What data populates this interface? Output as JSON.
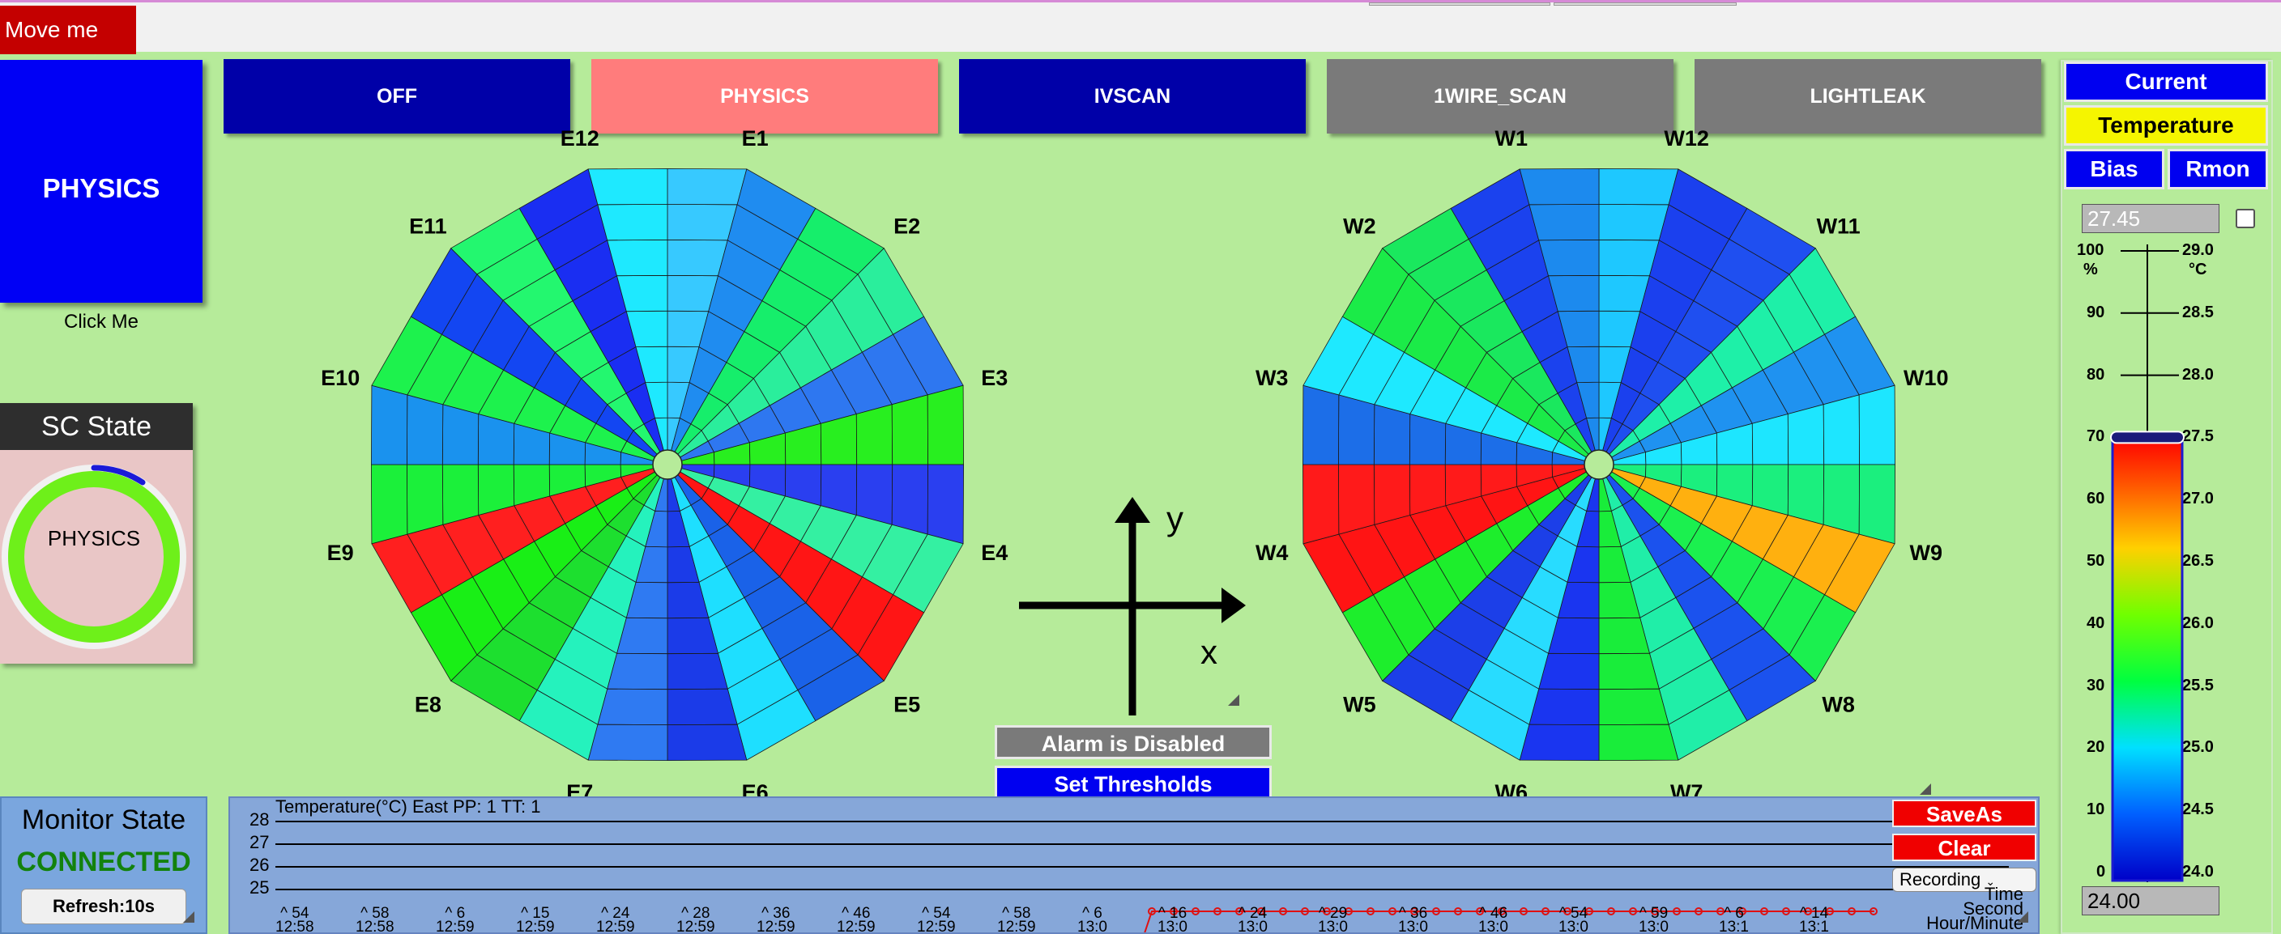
{
  "topbar": {
    "move_label": "Move me"
  },
  "modes": [
    {
      "label": "OFF",
      "color": "#0000a8"
    },
    {
      "label": "PHYSICS",
      "color": "#ff7c7c"
    },
    {
      "label": "IVSCAN",
      "color": "#0000a8"
    },
    {
      "label": "1WIRE_SCAN",
      "color": "#7a7a7a"
    },
    {
      "label": "LIGHTLEAK",
      "color": "#7a7a7a"
    }
  ],
  "physics_panel": {
    "title": "PHYSICS",
    "action": "Click Me"
  },
  "sc_state": {
    "title": "SC State",
    "value": "PHYSICS"
  },
  "monitor": {
    "title": "Monitor State",
    "status": "CONNECTED",
    "refresh": "Refresh:10s"
  },
  "east_wheel": {
    "labels": [
      "E1",
      "E2",
      "E3",
      "E4",
      "E5",
      "E6",
      "E7",
      "E8",
      "E9",
      "E10",
      "E11",
      "E12"
    ],
    "sector_colors": [
      "#37c9ff",
      "#1f8cf0",
      "#16ee6b",
      "#2aee9c",
      "#2e77f0",
      "#28ef1f",
      "#2a3ff0",
      "#34f0a2",
      "#ff1515",
      "#1a62e8",
      "#1edfff",
      "#1b3be8",
      "#2f7af2",
      "#25f2bd",
      "#1ddf2f",
      "#19ef16",
      "#ff1f1f",
      "#1bf03a",
      "#1a92ee",
      "#1df24d",
      "#1346f2",
      "#23f76f",
      "#1a2ef2",
      "#1ee9ff"
    ]
  },
  "west_wheel": {
    "labels": [
      "W1",
      "W2",
      "W3",
      "W4",
      "W5",
      "W6",
      "W7",
      "W8",
      "W9",
      "W10",
      "W11",
      "W12"
    ],
    "sector_colors": [
      "#1ec8ff",
      "#1b40ee",
      "#1f4ff0",
      "#1ef0a8",
      "#1f92f0",
      "#1de6ff",
      "#1bef7e",
      "#ffb00f",
      "#1bf04f",
      "#1b52ee",
      "#20eea8",
      "#19ed3a",
      "#1a35f0",
      "#28dcff",
      "#1c3fe8",
      "#1dee2c",
      "#ff1414",
      "#ff1a1a",
      "#1c6ee8",
      "#1ee9ff",
      "#1beb48",
      "#1ae85e",
      "#1b42ee",
      "#1c8aee"
    ]
  },
  "axes": {
    "x": "x",
    "y": "y"
  },
  "alarm": {
    "label": "Alarm is Disabled"
  },
  "thresholds": {
    "label": "Set Thresholds"
  },
  "plot": {
    "title": "Temperature(°C) East PP: 1 TT: 1",
    "yticks": [
      "28",
      "27",
      "26",
      "25"
    ],
    "xticks": [
      {
        "top": "^ 54",
        "bottom": "12:58"
      },
      {
        "top": "^ 58",
        "bottom": "12:58"
      },
      {
        "top": "^ 6",
        "bottom": "12:59"
      },
      {
        "top": "^ 15",
        "bottom": "12:59"
      },
      {
        "top": "^ 24",
        "bottom": "12:59"
      },
      {
        "top": "^ 28",
        "bottom": "12:59"
      },
      {
        "top": "^ 36",
        "bottom": "12:59"
      },
      {
        "top": "^ 46",
        "bottom": "12:59"
      },
      {
        "top": "^ 54",
        "bottom": "12:59"
      },
      {
        "top": "^ 58",
        "bottom": "12:59"
      },
      {
        "top": "^ 6",
        "bottom": "13:0"
      },
      {
        "top": "^ 16",
        "bottom": "13:0"
      },
      {
        "top": "^ 24",
        "bottom": "13:0"
      },
      {
        "top": "^ 29",
        "bottom": "13:0"
      },
      {
        "top": "^ 36",
        "bottom": "13:0"
      },
      {
        "top": "^ 46",
        "bottom": "13:0"
      },
      {
        "top": "^ 54",
        "bottom": "13:0"
      },
      {
        "top": "^ 59",
        "bottom": "13:0"
      },
      {
        "top": "^ 6",
        "bottom": "13:1"
      },
      {
        "top": "^ 14",
        "bottom": "13:1"
      }
    ],
    "saveas": "SaveAs",
    "clear": "Clear",
    "recording": "Recording",
    "time_label": [
      "Time",
      "Second",
      "Hour/Minute"
    ]
  },
  "right_panel": {
    "current": "Current",
    "temperature": "Temperature",
    "bias": "Bias",
    "rmon": "Rmon",
    "max_value": "27.45",
    "min_value": "24.00",
    "pct_labels": [
      "100",
      "90",
      "80",
      "70",
      "60",
      "50",
      "40",
      "30",
      "20",
      "10",
      "0"
    ],
    "pct_unit": "%",
    "temp_labels": [
      "29.0",
      "28.5",
      "28.0",
      "27.5",
      "27.0",
      "26.5",
      "26.0",
      "25.5",
      "25.0",
      "24.5",
      "24.0"
    ],
    "temp_unit": "°C",
    "level_pct": 70
  }
}
